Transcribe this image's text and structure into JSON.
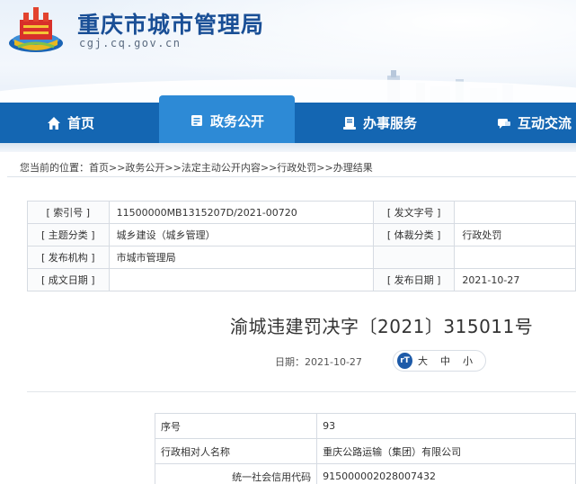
{
  "header": {
    "title": "重庆市城市管理局",
    "domain": "cgj.cq.gov.cn"
  },
  "nav": {
    "items": [
      {
        "label": "首页",
        "icon": "home-icon"
      },
      {
        "label": "政务公开",
        "icon": "document-icon"
      },
      {
        "label": "办事服务",
        "icon": "service-icon"
      },
      {
        "label": "互动交流",
        "icon": "chat-icon"
      }
    ],
    "active_index": 1
  },
  "breadcrumb": {
    "prefix": "您当前的位置：",
    "path": "首页>>政务公开>>法定主动公开内容>>行政处罚>>办理结果"
  },
  "meta": {
    "rows": [
      {
        "k1": "[ 索引号 ]",
        "v1": "11500000MB1315207D/2021-00720",
        "k2": "[ 发文字号 ]",
        "v2": ""
      },
      {
        "k1": "[ 主题分类 ]",
        "v1": "城乡建设（城乡管理）",
        "k2": "[ 体裁分类 ]",
        "v2": "行政处罚"
      },
      {
        "k1": "[ 发布机构 ]",
        "v1": "市城市管理局",
        "k2": "",
        "v2": ""
      },
      {
        "k1": "[ 成文日期 ]",
        "v1": "",
        "k2": "[ 发布日期 ]",
        "v2": "2021-10-27"
      }
    ]
  },
  "document": {
    "title": "渝城违建罚决字〔2021〕315011号",
    "date": "日期：2021-10-27",
    "font_size": {
      "icon_label": "rT",
      "large": "大",
      "medium": "中",
      "small": "小"
    }
  },
  "content": {
    "rows": [
      {
        "k": "序号",
        "v": "93"
      },
      {
        "k": "行政相对人名称",
        "v": "重庆公路运输（集团）有限公司"
      },
      {
        "k": "统一社会信用代码",
        "v": "915000002028007432"
      }
    ]
  },
  "colors": {
    "brand_blue": "#1466b2",
    "nav_active": "#2d8ad6",
    "title_blue": "#1a4f96"
  }
}
